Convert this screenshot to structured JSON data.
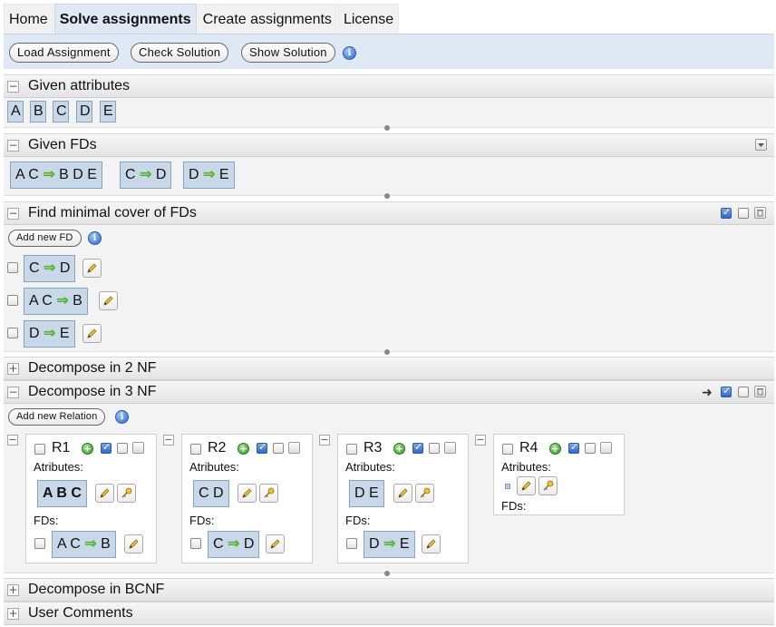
{
  "tabs": [
    "Home",
    "Solve assignments",
    "Create assignments",
    "License"
  ],
  "toolbar": {
    "load": "Load Assignment",
    "check": "Check Solution",
    "show": "Show Solution",
    "info": "i"
  },
  "sections": {
    "given_attributes": {
      "title": "Given attributes",
      "toggle": "−",
      "attrs": [
        "A",
        "B",
        "C",
        "D",
        "E"
      ]
    },
    "given_fds": {
      "title": "Given FDs",
      "toggle": "−",
      "fds": [
        {
          "lhs": "A C",
          "arrow": "⇒",
          "rhs": "B D E"
        },
        {
          "lhs": "C",
          "arrow": "⇒",
          "rhs": "D"
        },
        {
          "lhs": "D",
          "arrow": "⇒",
          "rhs": "E"
        }
      ]
    },
    "minimal_cover": {
      "title": "Find minimal cover of FDs",
      "toggle": "−",
      "add_label": "Add new FD",
      "fds": [
        {
          "lhs": "C",
          "arrow": "⇒",
          "rhs": "D"
        },
        {
          "lhs": "A C",
          "arrow": "⇒",
          "rhs": "B"
        },
        {
          "lhs": "D",
          "arrow": "⇒",
          "rhs": "E"
        }
      ]
    },
    "decompose_2nf": {
      "title": "Decompose in 2 NF",
      "toggle": "+"
    },
    "decompose_3nf": {
      "title": "Decompose in 3 NF",
      "toggle": "−",
      "add_label": "Add new Relation",
      "relations": [
        {
          "name": "R1",
          "attr_label": "Atributes:",
          "attrs": "A B C",
          "fd_label": "FDs:",
          "fd": {
            "lhs": "A C",
            "arrow": "⇒",
            "rhs": "B"
          }
        },
        {
          "name": "R2",
          "attr_label": "Atributes:",
          "attrs": "C D",
          "fd_label": "FDs:",
          "fd": {
            "lhs": "C",
            "arrow": "⇒",
            "rhs": "D"
          }
        },
        {
          "name": "R3",
          "attr_label": "Atributes:",
          "attrs": "D E",
          "fd_label": "FDs:",
          "fd": {
            "lhs": "D",
            "arrow": "⇒",
            "rhs": "E"
          }
        },
        {
          "name": "R4",
          "attr_label": "Atributes:",
          "attrs": "",
          "fd_label": "FDs:"
        }
      ]
    },
    "decompose_bcnf": {
      "title": "Decompose in BCNF",
      "toggle": "+"
    },
    "user_comments": {
      "title": "User Comments",
      "toggle": "+"
    }
  }
}
